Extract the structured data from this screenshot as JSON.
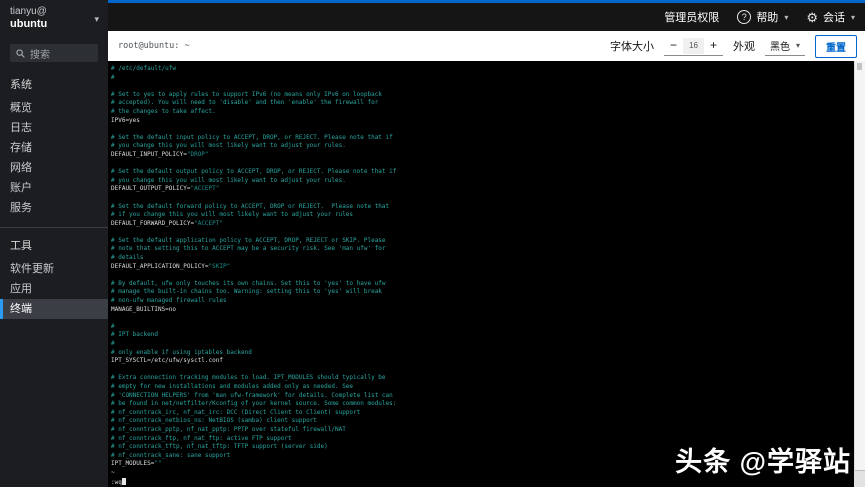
{
  "masthead": {
    "admin_label": "管理员权限",
    "help_label": "帮助",
    "help_icon_glyph": "?",
    "session_label": "会话",
    "gear_icon_glyph": "⚙",
    "caret_glyph": "▾"
  },
  "sidebar": {
    "user_line1": "tianyu@",
    "user_line2": "ubuntu",
    "caret_glyph": "▾",
    "search_placeholder": "搜索",
    "sections": [
      {
        "header": "系统",
        "items": [
          "概览",
          "日志",
          "存储",
          "网络",
          "账户",
          "服务"
        ]
      },
      {
        "header": "工具",
        "items": [
          "软件更新",
          "应用",
          "终端"
        ]
      }
    ],
    "selected_item": "终端"
  },
  "terminal_bar": {
    "title": "root@ubuntu: ~",
    "font_size_label": "字体大小",
    "decrease_label": "−",
    "font_size_value": "16",
    "increase_label": "+",
    "appearance_label": "外观",
    "theme_value": "黑色",
    "theme_caret": "▾",
    "reset_label": "重置"
  },
  "terminal": {
    "lines": [
      [
        [
          "# /etc/default/ufw",
          "c"
        ]
      ],
      [
        [
          "#",
          "c"
        ]
      ],
      [],
      [
        [
          "# Set to yes to apply rules to support IPv6 (no means only IPv6 on loopback",
          "c"
        ]
      ],
      [
        [
          "# accepted). You will need to 'disable' and then 'enable' the firewall for",
          "c"
        ]
      ],
      [
        [
          "# the changes to take affect.",
          "c"
        ]
      ],
      [
        [
          "IPV6=yes",
          "p"
        ]
      ],
      [],
      [
        [
          "# Set the default input policy to ACCEPT, DROP, or REJECT. Please note that if",
          "c"
        ]
      ],
      [
        [
          "# you change this you will most likely want to adjust your rules.",
          "c"
        ]
      ],
      [
        [
          "DEFAULT_INPUT_POLICY=",
          "p"
        ],
        [
          "\"DROP\"",
          "s"
        ]
      ],
      [],
      [
        [
          "# Set the default output policy to ACCEPT, DROP, or REJECT. Please note that if",
          "c"
        ]
      ],
      [
        [
          "# you change this you will most likely want to adjust your rules.",
          "c"
        ]
      ],
      [
        [
          "DEFAULT_OUTPUT_POLICY=",
          "p"
        ],
        [
          "\"ACCEPT\"",
          "s"
        ]
      ],
      [],
      [
        [
          "# Set the default forward policy to ACCEPT, DROP or REJECT.  Please note that",
          "c"
        ]
      ],
      [
        [
          "# if you change this you will most likely want to adjust your rules",
          "c"
        ]
      ],
      [
        [
          "DEFAULT_FORWARD_POLICY=",
          "p"
        ],
        [
          "\"ACCEPT\"",
          "s"
        ]
      ],
      [],
      [
        [
          "# Set the default application policy to ACCEPT, DROP, REJECT or SKIP. Please",
          "c"
        ]
      ],
      [
        [
          "# note that setting this to ACCEPT may be a security risk. See 'man ufw' for",
          "c"
        ]
      ],
      [
        [
          "# details",
          "c"
        ]
      ],
      [
        [
          "DEFAULT_APPLICATION_POLICY=",
          "p"
        ],
        [
          "\"SKIP\"",
          "s"
        ]
      ],
      [],
      [
        [
          "# By default, ufw only touches its own chains. Set this to 'yes' to have ufw",
          "c"
        ]
      ],
      [
        [
          "# manage the built-in chains too. Warning: setting this to 'yes' will break",
          "c"
        ]
      ],
      [
        [
          "# non-ufw managed firewall rules",
          "c"
        ]
      ],
      [
        [
          "MANAGE_BUILTINS=no",
          "p"
        ]
      ],
      [],
      [
        [
          "#",
          "c"
        ]
      ],
      [
        [
          "# IPT backend",
          "c"
        ]
      ],
      [
        [
          "#",
          "c"
        ]
      ],
      [
        [
          "# only enable if using iptables backend",
          "c"
        ]
      ],
      [
        [
          "IPT_SYSCTL=/etc/ufw/sysctl.conf",
          "p"
        ]
      ],
      [],
      [
        [
          "# Extra connection tracking modules to load. IPT_MODULES should typically be",
          "c"
        ]
      ],
      [
        [
          "# empty for new installations and modules added only as needed. See",
          "c"
        ]
      ],
      [
        [
          "# 'CONNECTION HELPERS' from 'man ufw-framework' for details. Complete list can",
          "c"
        ]
      ],
      [
        [
          "# be found in net/netfilter/Kconfig of your kernel source. Some common modules:",
          "c"
        ]
      ],
      [
        [
          "# nf_conntrack_irc, nf_nat_irc: DCC (Direct Client to Client) support",
          "c"
        ]
      ],
      [
        [
          "# nf_conntrack_netbios_ns: NetBIOS (samba) client support",
          "c"
        ]
      ],
      [
        [
          "# nf_conntrack_pptp, nf_nat_pptp: PPTP over stateful firewall/NAT",
          "c"
        ]
      ],
      [
        [
          "# nf_conntrack_ftp, nf_nat_ftp: active FTP support",
          "c"
        ]
      ],
      [
        [
          "# nf_conntrack_tftp, nf_nat_tftp: TFTP support (server side)",
          "c"
        ]
      ],
      [
        [
          "# nf_conntrack_sane: sane support",
          "c"
        ]
      ],
      [
        [
          "IPT_MODULES=",
          "p"
        ],
        [
          "\"\"",
          "s"
        ]
      ],
      [
        [
          "~",
          "p"
        ]
      ],
      [
        [
          ":wq",
          "p"
        ]
      ]
    ],
    "cursor_on_last_line": true
  },
  "watermark": "头条 @学驿站",
  "colors": {
    "accent_blue": "#0066cc",
    "masthead_bg": "#151515",
    "sidebar_bg": "#1b1d21",
    "selected_border": "#2b9af3",
    "terminal_bg": "#000000",
    "comment_teal": "#2aa5a0",
    "string_teal": "#1e8f8f",
    "plain_text": "#dcdcdc"
  }
}
